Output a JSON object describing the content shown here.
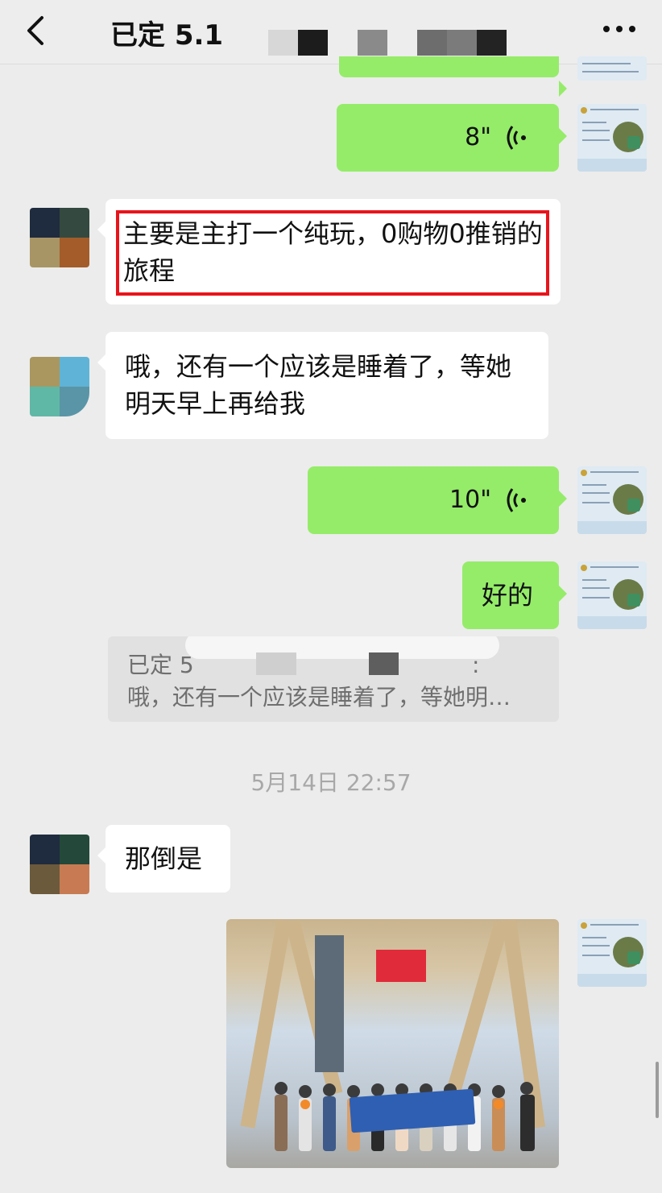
{
  "header": {
    "title": "已定 5.12",
    "back_icon": "chevron-left-icon",
    "more_icon": "more-dots-icon"
  },
  "messages": [
    {
      "side": "right",
      "kind": "voice",
      "duration": "8\""
    },
    {
      "side": "left",
      "kind": "text",
      "highlighted": true,
      "text": "主要是主打一个纯玩，0购物0推销的旅程"
    },
    {
      "side": "left",
      "kind": "text",
      "text": "哦，还有一个应该是睡着了，等她明天早上再给我"
    },
    {
      "side": "right",
      "kind": "voice",
      "duration": "10\""
    },
    {
      "side": "right",
      "kind": "text",
      "text": "好的"
    },
    {
      "side": "left",
      "kind": "text",
      "text": "那倒是"
    },
    {
      "side": "right",
      "kind": "image",
      "icon": "group-photo-image"
    }
  ],
  "quote": {
    "line1": "已定 5",
    "line1_suffix": ":",
    "line2": "哦，还有一个应该是睡着了，等她明…"
  },
  "timestamp": "5月14日 22:57",
  "colors": {
    "bubble_green": "#95ec69",
    "bubble_white": "#ffffff",
    "highlight_red": "#e8141c",
    "background": "#ececec"
  }
}
